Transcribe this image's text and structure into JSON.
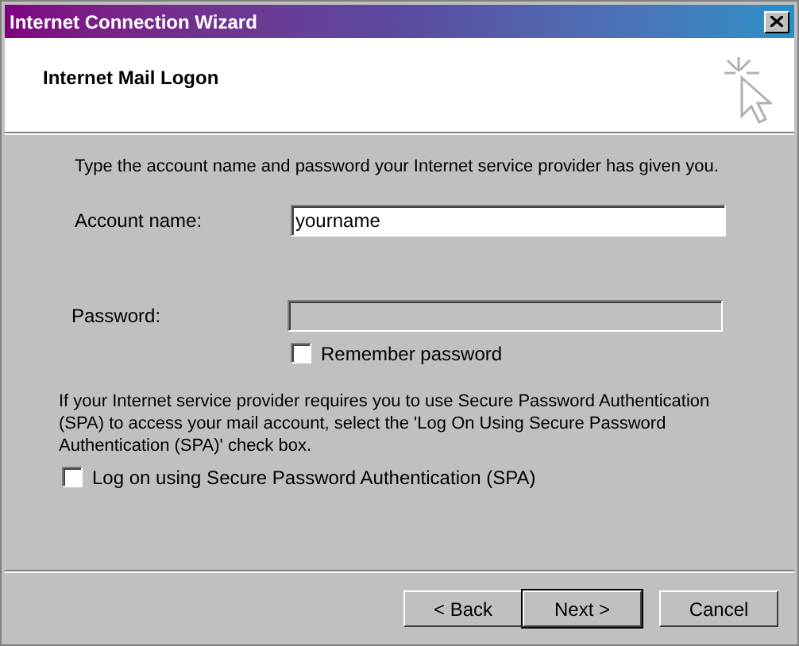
{
  "window": {
    "title": "Internet Connection Wizard"
  },
  "header": {
    "title": "Internet Mail Logon"
  },
  "intro": "Type the account name and password your Internet service provider has given you.",
  "fields": [
    {
      "label": "Account name:",
      "value": "yourname",
      "disabled": false
    },
    {
      "label": "Password:",
      "disabled": true
    }
  ],
  "remember_password": {
    "label": "Remember password",
    "checked": false
  },
  "spa_note": "If your Internet service provider requires you to use Secure Password Authentication (SPA) to access your mail account, select the 'Log On Using Secure Password Authentication (SPA)' check box.",
  "spa_checkbox": {
    "label": "Log on using Secure Password Authentication (SPA)",
    "checked": false
  },
  "buttons": [
    {
      "label": "< Back",
      "default": false
    },
    {
      "label": "Next >",
      "default": true
    },
    {
      "label": "Cancel",
      "default": false
    }
  ]
}
